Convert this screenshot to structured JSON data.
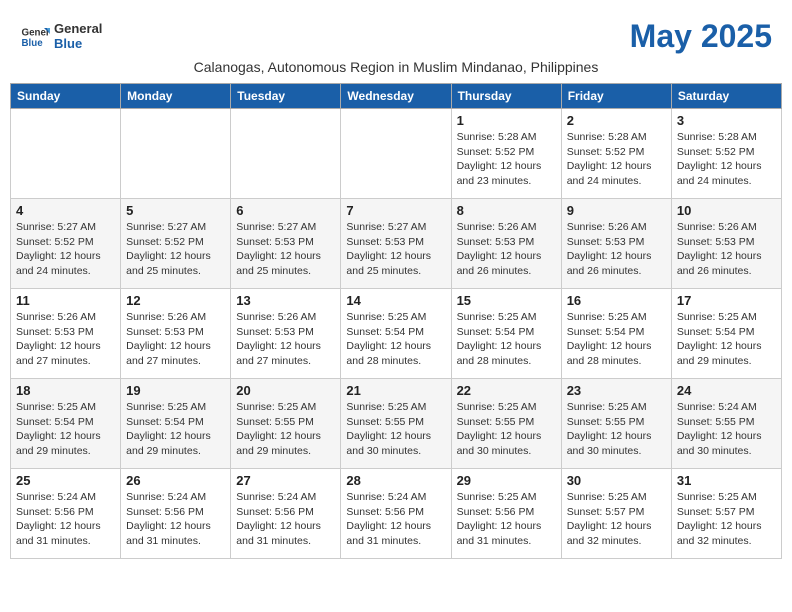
{
  "header": {
    "logo_line1": "General",
    "logo_line2": "Blue",
    "month_title": "May 2025",
    "subtitle": "Calanogas, Autonomous Region in Muslim Mindanao, Philippines"
  },
  "weekdays": [
    "Sunday",
    "Monday",
    "Tuesday",
    "Wednesday",
    "Thursday",
    "Friday",
    "Saturday"
  ],
  "weeks": [
    [
      {
        "day": "",
        "info": ""
      },
      {
        "day": "",
        "info": ""
      },
      {
        "day": "",
        "info": ""
      },
      {
        "day": "",
        "info": ""
      },
      {
        "day": "1",
        "info": "Sunrise: 5:28 AM\nSunset: 5:52 PM\nDaylight: 12 hours\nand 23 minutes."
      },
      {
        "day": "2",
        "info": "Sunrise: 5:28 AM\nSunset: 5:52 PM\nDaylight: 12 hours\nand 24 minutes."
      },
      {
        "day": "3",
        "info": "Sunrise: 5:28 AM\nSunset: 5:52 PM\nDaylight: 12 hours\nand 24 minutes."
      }
    ],
    [
      {
        "day": "4",
        "info": "Sunrise: 5:27 AM\nSunset: 5:52 PM\nDaylight: 12 hours\nand 24 minutes."
      },
      {
        "day": "5",
        "info": "Sunrise: 5:27 AM\nSunset: 5:52 PM\nDaylight: 12 hours\nand 25 minutes."
      },
      {
        "day": "6",
        "info": "Sunrise: 5:27 AM\nSunset: 5:53 PM\nDaylight: 12 hours\nand 25 minutes."
      },
      {
        "day": "7",
        "info": "Sunrise: 5:27 AM\nSunset: 5:53 PM\nDaylight: 12 hours\nand 25 minutes."
      },
      {
        "day": "8",
        "info": "Sunrise: 5:26 AM\nSunset: 5:53 PM\nDaylight: 12 hours\nand 26 minutes."
      },
      {
        "day": "9",
        "info": "Sunrise: 5:26 AM\nSunset: 5:53 PM\nDaylight: 12 hours\nand 26 minutes."
      },
      {
        "day": "10",
        "info": "Sunrise: 5:26 AM\nSunset: 5:53 PM\nDaylight: 12 hours\nand 26 minutes."
      }
    ],
    [
      {
        "day": "11",
        "info": "Sunrise: 5:26 AM\nSunset: 5:53 PM\nDaylight: 12 hours\nand 27 minutes."
      },
      {
        "day": "12",
        "info": "Sunrise: 5:26 AM\nSunset: 5:53 PM\nDaylight: 12 hours\nand 27 minutes."
      },
      {
        "day": "13",
        "info": "Sunrise: 5:26 AM\nSunset: 5:53 PM\nDaylight: 12 hours\nand 27 minutes."
      },
      {
        "day": "14",
        "info": "Sunrise: 5:25 AM\nSunset: 5:54 PM\nDaylight: 12 hours\nand 28 minutes."
      },
      {
        "day": "15",
        "info": "Sunrise: 5:25 AM\nSunset: 5:54 PM\nDaylight: 12 hours\nand 28 minutes."
      },
      {
        "day": "16",
        "info": "Sunrise: 5:25 AM\nSunset: 5:54 PM\nDaylight: 12 hours\nand 28 minutes."
      },
      {
        "day": "17",
        "info": "Sunrise: 5:25 AM\nSunset: 5:54 PM\nDaylight: 12 hours\nand 29 minutes."
      }
    ],
    [
      {
        "day": "18",
        "info": "Sunrise: 5:25 AM\nSunset: 5:54 PM\nDaylight: 12 hours\nand 29 minutes."
      },
      {
        "day": "19",
        "info": "Sunrise: 5:25 AM\nSunset: 5:54 PM\nDaylight: 12 hours\nand 29 minutes."
      },
      {
        "day": "20",
        "info": "Sunrise: 5:25 AM\nSunset: 5:55 PM\nDaylight: 12 hours\nand 29 minutes."
      },
      {
        "day": "21",
        "info": "Sunrise: 5:25 AM\nSunset: 5:55 PM\nDaylight: 12 hours\nand 30 minutes."
      },
      {
        "day": "22",
        "info": "Sunrise: 5:25 AM\nSunset: 5:55 PM\nDaylight: 12 hours\nand 30 minutes."
      },
      {
        "day": "23",
        "info": "Sunrise: 5:25 AM\nSunset: 5:55 PM\nDaylight: 12 hours\nand 30 minutes."
      },
      {
        "day": "24",
        "info": "Sunrise: 5:24 AM\nSunset: 5:55 PM\nDaylight: 12 hours\nand 30 minutes."
      }
    ],
    [
      {
        "day": "25",
        "info": "Sunrise: 5:24 AM\nSunset: 5:56 PM\nDaylight: 12 hours\nand 31 minutes."
      },
      {
        "day": "26",
        "info": "Sunrise: 5:24 AM\nSunset: 5:56 PM\nDaylight: 12 hours\nand 31 minutes."
      },
      {
        "day": "27",
        "info": "Sunrise: 5:24 AM\nSunset: 5:56 PM\nDaylight: 12 hours\nand 31 minutes."
      },
      {
        "day": "28",
        "info": "Sunrise: 5:24 AM\nSunset: 5:56 PM\nDaylight: 12 hours\nand 31 minutes."
      },
      {
        "day": "29",
        "info": "Sunrise: 5:25 AM\nSunset: 5:56 PM\nDaylight: 12 hours\nand 31 minutes."
      },
      {
        "day": "30",
        "info": "Sunrise: 5:25 AM\nSunset: 5:57 PM\nDaylight: 12 hours\nand 32 minutes."
      },
      {
        "day": "31",
        "info": "Sunrise: 5:25 AM\nSunset: 5:57 PM\nDaylight: 12 hours\nand 32 minutes."
      }
    ]
  ]
}
